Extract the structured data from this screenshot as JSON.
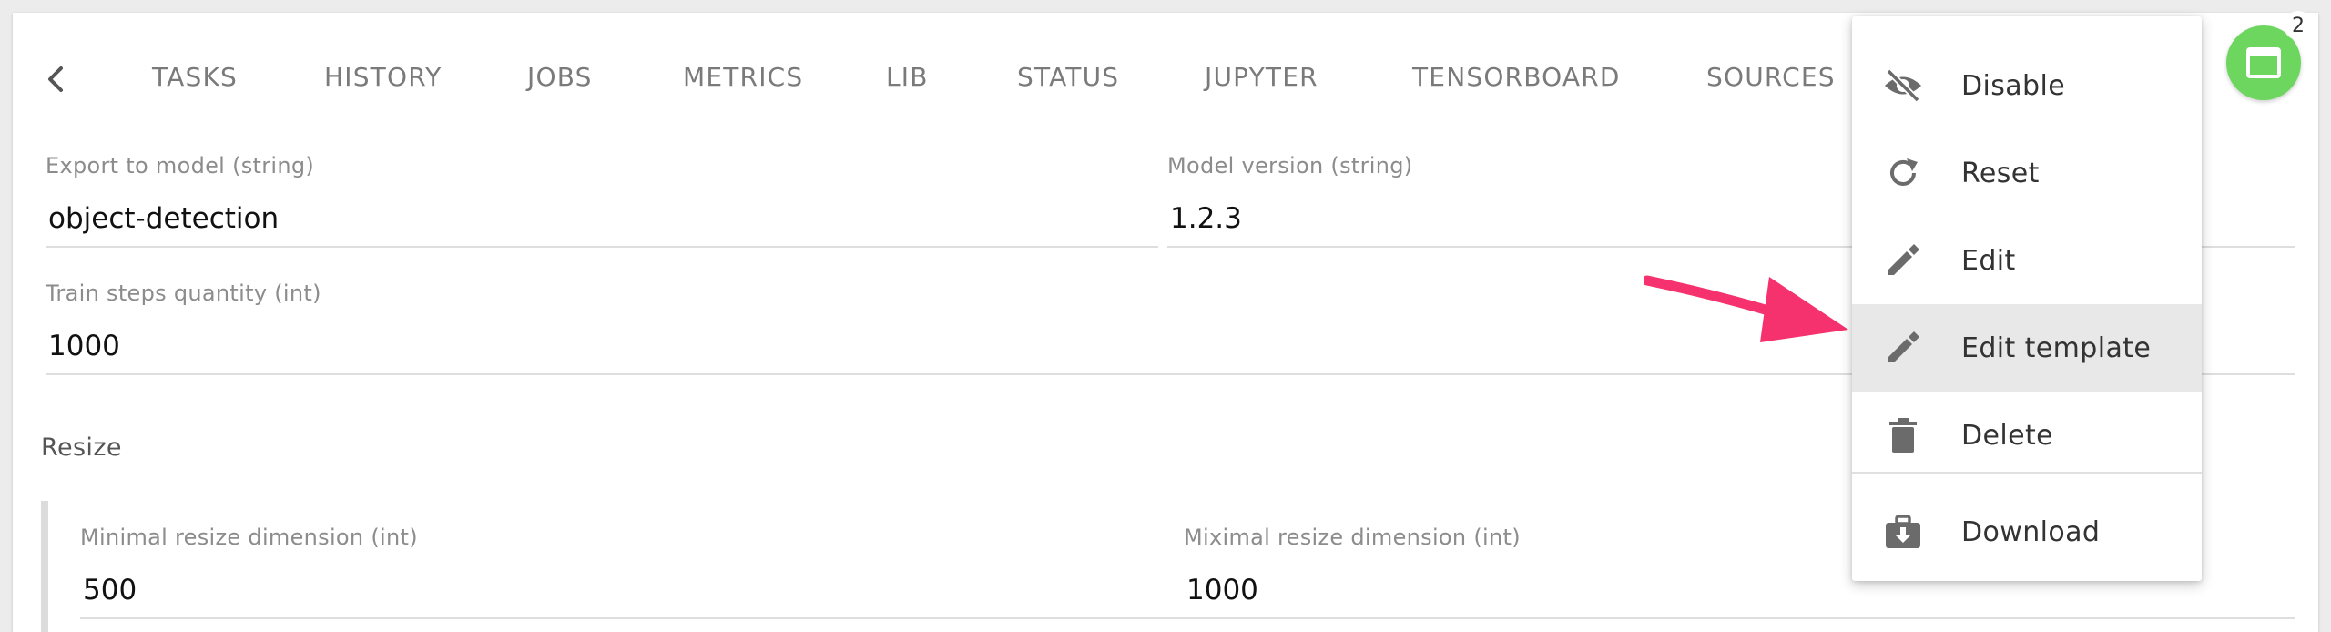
{
  "nav": {
    "tabs": [
      {
        "label": "TASKS"
      },
      {
        "label": "HISTORY"
      },
      {
        "label": "JOBS"
      },
      {
        "label": "METRICS"
      },
      {
        "label": "LIB"
      },
      {
        "label": "STATUS"
      },
      {
        "label": "JUPYTER"
      },
      {
        "label": "TENSORBOARD"
      },
      {
        "label": "SOURCES"
      }
    ]
  },
  "form": {
    "export_model": {
      "label": "Export to model (string)",
      "value": "object-detection"
    },
    "model_version": {
      "label": "Model version (string)",
      "value": "1.2.3"
    },
    "train_steps": {
      "label": "Train steps quantity (int)",
      "value": "1000"
    },
    "resize_section": "Resize",
    "min_resize": {
      "label": "Minimal resize dimension (int)",
      "value": "500"
    },
    "max_resize": {
      "label": "Miximal resize dimension (int)",
      "value": "1000"
    }
  },
  "fab": {
    "badge_count": "2",
    "icon": "window-icon",
    "color": "#6cd65f"
  },
  "menu": {
    "items": [
      {
        "label": "Disable",
        "icon": "eye-off-icon"
      },
      {
        "label": "Reset",
        "icon": "refresh-icon"
      },
      {
        "label": "Edit",
        "icon": "pencil-icon"
      },
      {
        "label": "Edit template",
        "icon": "pencil-icon"
      },
      {
        "label": "Delete",
        "icon": "trash-icon"
      },
      {
        "label": "Download",
        "icon": "download-briefcase-icon"
      }
    ],
    "highlighted_item": "Edit template"
  },
  "annotation": {
    "arrow_color": "#f5326e"
  }
}
